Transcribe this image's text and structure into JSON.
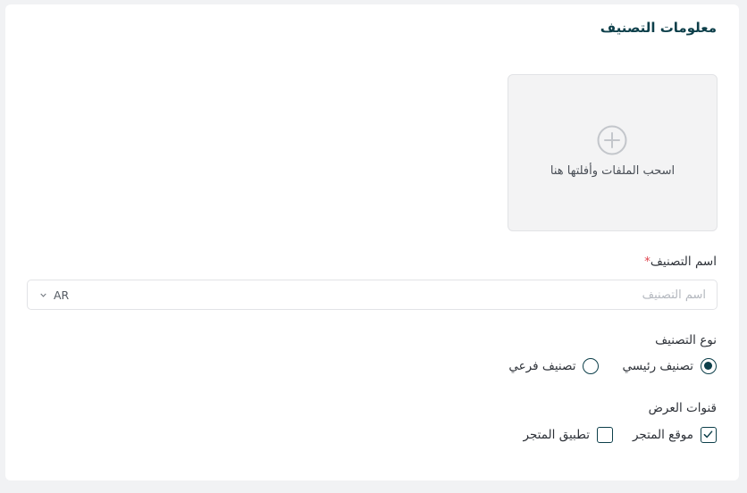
{
  "section": {
    "title": "معلومات التصنيف"
  },
  "upload": {
    "icon": "plus-circle-icon",
    "text": "اسحب الملفات وأفلتها هنا"
  },
  "category_name": {
    "label": "اسم التصنيف",
    "required_mark": "*",
    "placeholder": "اسم التصنيف",
    "value": "",
    "language": "AR"
  },
  "category_type": {
    "label": "نوع التصنيف",
    "options": [
      {
        "label": "تصنيف رئيسي",
        "checked": true
      },
      {
        "label": "تصنيف فرعي",
        "checked": false
      }
    ]
  },
  "display_channels": {
    "label": "قنوات العرض",
    "options": [
      {
        "label": "موقع المتجر",
        "checked": true
      },
      {
        "label": "تطبيق المتجر",
        "checked": false
      }
    ]
  },
  "colors": {
    "accent": "#0d3f4a",
    "required": "#e0454f"
  }
}
